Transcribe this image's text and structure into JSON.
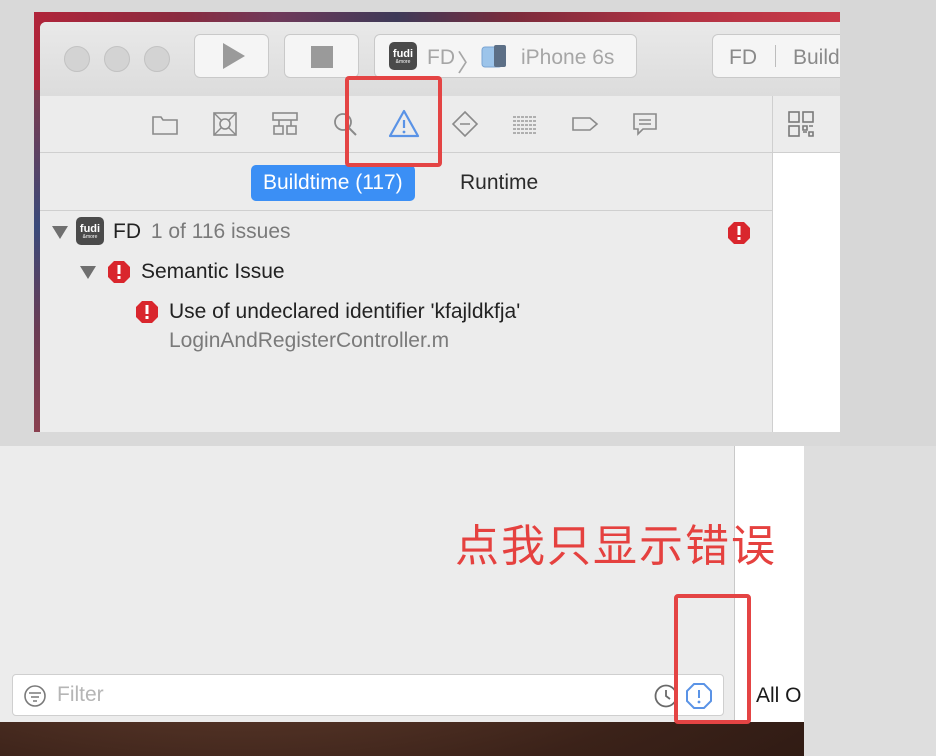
{
  "window": {
    "scheme_project": "FD",
    "scheme_device": "iPhone 6s",
    "activity_project": "FD",
    "activity_status": "Build"
  },
  "navigator_icons": [
    "folder-icon",
    "symbol-icon",
    "hierarchy-icon",
    "search-icon",
    "warning-icon",
    "test-icon",
    "debug-icon",
    "breakpoint-icon",
    "report-icon"
  ],
  "tabs": {
    "buildtime": "Buildtime (117)",
    "runtime": "Runtime"
  },
  "issues": {
    "project_name": "FD",
    "project_count": "1 of 116 issues",
    "group_label": "Semantic Issue",
    "issue_message": "Use of undeclared identifier 'kfajldkfja'",
    "issue_file": "LoginAndRegisterController.m"
  },
  "annotation": {
    "note": "点我只显示错误"
  },
  "filter": {
    "placeholder": "Filter",
    "all_label": "All O"
  },
  "logo": {
    "text": "fudi",
    "sub": "&more"
  },
  "colors": {
    "accent": "#3b8ff5",
    "error": "#d9262d",
    "highlight": "#e44444",
    "warning_icon": "#5a93e6"
  }
}
